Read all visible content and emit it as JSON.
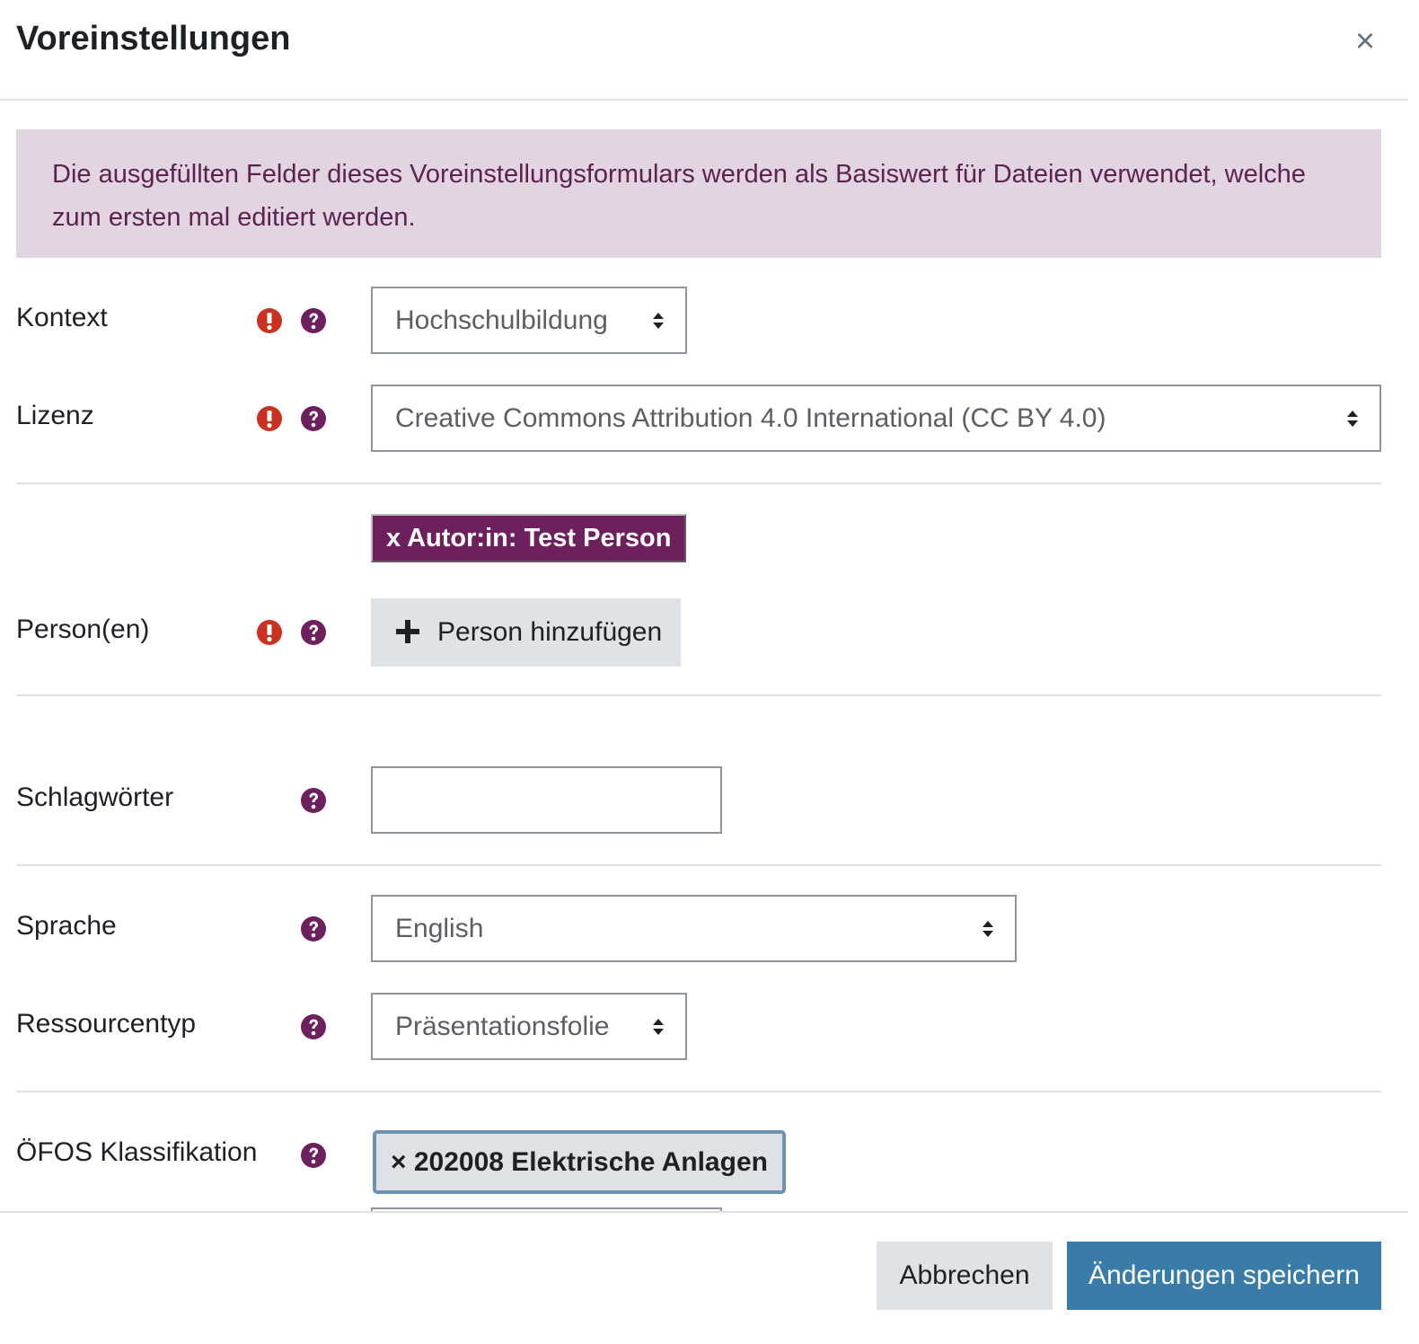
{
  "modal": {
    "title": "Voreinstellungen",
    "close_icon": "close-icon"
  },
  "alert": {
    "text": "Die ausgefüllten Felder dieses Voreinstellungsformulars werden als Basiswert für Dateien verwendet, welche zum ersten mal editiert werden."
  },
  "form": {
    "kontext": {
      "label": "Kontext",
      "value": "Hochschulbildung",
      "required": true
    },
    "lizenz": {
      "label": "Lizenz",
      "value": "Creative Commons Attribution 4.0 International (CC BY 4.0)",
      "required": true
    },
    "personen": {
      "label": "Person(en)",
      "tag": "x Autor:in: Test Person",
      "add_button": "Person hinzufügen",
      "required": true
    },
    "schlagwoerter": {
      "label": "Schlagwörter",
      "value": ""
    },
    "sprache": {
      "label": "Sprache",
      "value": "English"
    },
    "ressourcentyp": {
      "label": "Ressourcentyp",
      "value": "Präsentationsfolie"
    },
    "oefos": {
      "label": "ÖFOS Klassifikation",
      "tag": "× 202008 Elektrische Anlagen"
    }
  },
  "footer": {
    "cancel_label": "Abbrechen",
    "save_label": "Änderungen speichern"
  },
  "colors": {
    "accent": "#6d1f5e",
    "required": "#ca3120",
    "alert_bg": "#e2d4e1",
    "primary_button": "#3a7ca8",
    "secondary_button": "#dfe2e6"
  }
}
